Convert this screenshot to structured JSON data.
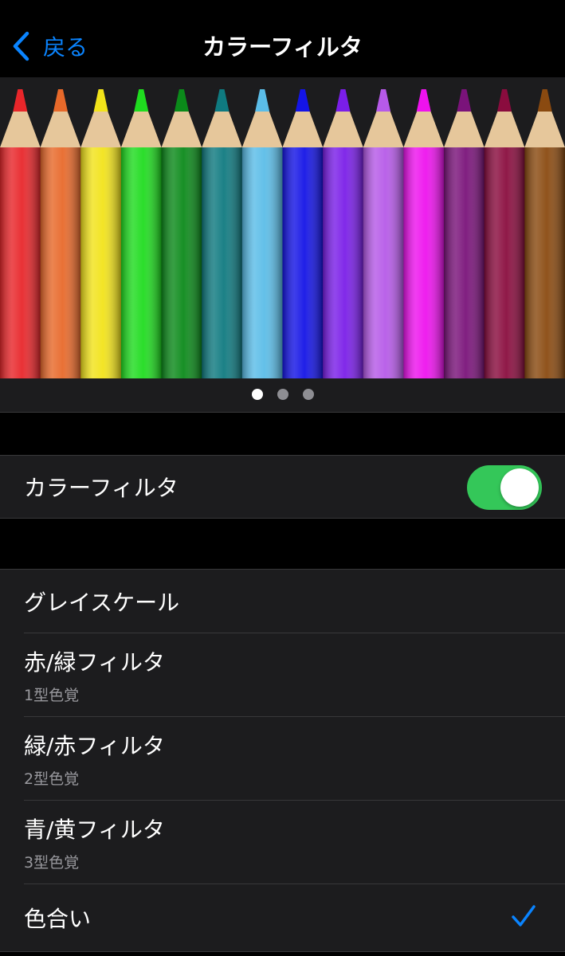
{
  "nav": {
    "back_label": "戻る",
    "title": "カラーフィルタ"
  },
  "preview": {
    "pencil_colors": [
      "#e8262a",
      "#e8692a",
      "#f2e31a",
      "#1fdc1f",
      "#0b8a1a",
      "#0f7a80",
      "#5bbde8",
      "#1414e6",
      "#7a1ee8",
      "#b65ae8",
      "#ee12ee",
      "#7a137a",
      "#8a0c3e",
      "#8a4a10"
    ],
    "page_count": 3,
    "current_page": 1
  },
  "filter_toggle": {
    "label": "カラーフィルタ",
    "on": true
  },
  "options": [
    {
      "label": "グレイスケール",
      "sub": ""
    },
    {
      "label": "赤/緑フィルタ",
      "sub": "1型色覚"
    },
    {
      "label": "緑/赤フィルタ",
      "sub": "2型色覚"
    },
    {
      "label": "青/黄フィルタ",
      "sub": "3型色覚"
    },
    {
      "label": "色合い",
      "sub": "",
      "selected": true
    }
  ],
  "colors": {
    "accent": "#0a84ff",
    "toggle_on": "#34c759",
    "cell_bg": "#1c1c1e",
    "background": "#000000"
  }
}
